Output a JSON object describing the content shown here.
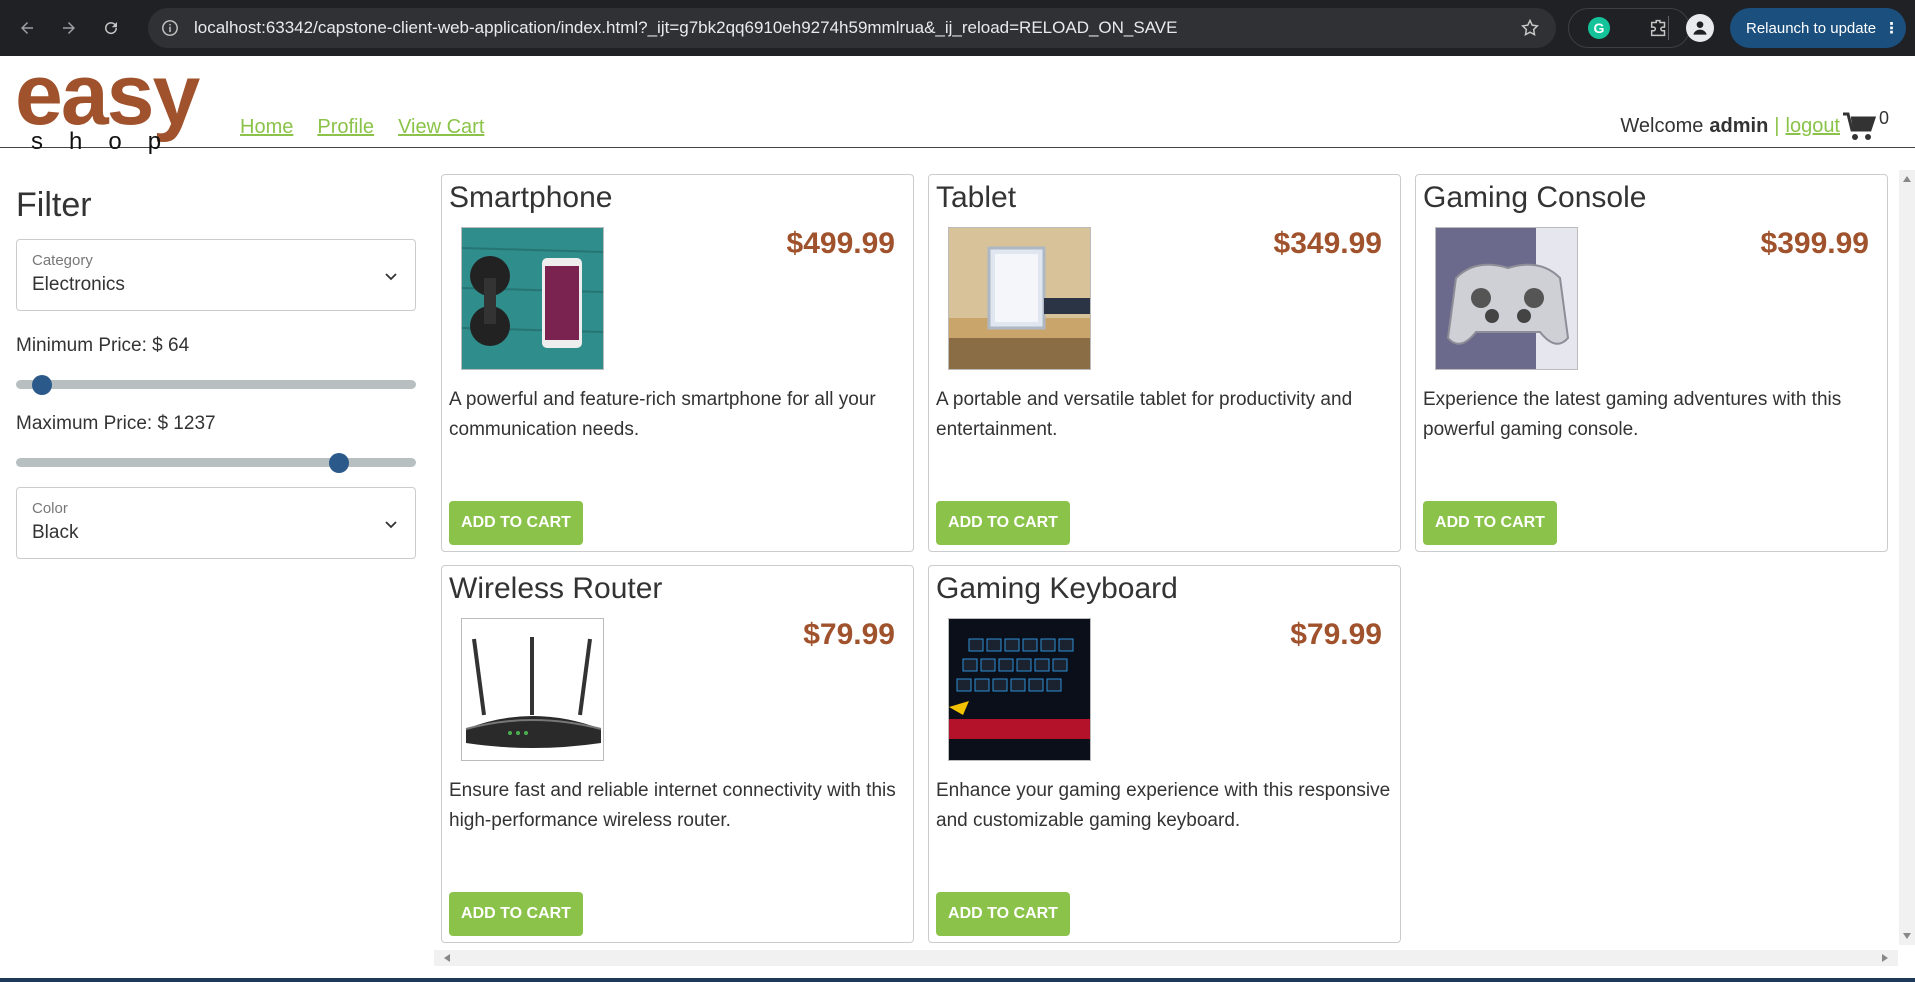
{
  "browser": {
    "url": "localhost:63342/capstone-client-web-application/index.html?_ijt=g7bk2qq6910eh9274h59mmlrua&_ij_reload=RELOAD_ON_SAVE",
    "relaunch_label": "Relaunch to update",
    "relaunch_menu": "⋮",
    "extension_letter": "G"
  },
  "header": {
    "logo_top": "easy",
    "logo_bottom": "shop",
    "nav": {
      "home": "Home",
      "profile": "Profile",
      "cart": "View Cart"
    },
    "welcome": "Welcome",
    "username": "admin",
    "separator": "|",
    "logout": "logout",
    "cart_count": "0"
  },
  "filter": {
    "title": "Filter",
    "category": {
      "label": "Category",
      "value": "Electronics"
    },
    "min_price": {
      "label": "Minimum Price: $ 64",
      "value": 64,
      "min": 0,
      "max": 1500
    },
    "max_price": {
      "label": "Maximum Price: $ 1237",
      "value": 1237,
      "min": 0,
      "max": 1500
    },
    "color": {
      "label": "Color",
      "value": "Black"
    }
  },
  "products": [
    {
      "name": "Smartphone",
      "price": "$499.99",
      "description": "A powerful and feature-rich smartphone for all your communication needs.",
      "button": "ADD TO CART"
    },
    {
      "name": "Tablet",
      "price": "$349.99",
      "description": "A portable and versatile tablet for productivity and entertainment.",
      "button": "ADD TO CART"
    },
    {
      "name": "Gaming Console",
      "price": "$399.99",
      "description": "Experience the latest gaming adventures with this powerful gaming console.",
      "button": "ADD TO CART"
    },
    {
      "name": "Wireless Router",
      "price": "$79.99",
      "description": "Ensure fast and reliable internet connectivity with this high-performance wireless router.",
      "button": "ADD TO CART"
    },
    {
      "name": "Gaming Keyboard",
      "price": "$79.99",
      "description": "Enhance your gaming experience with this responsive and customizable gaming keyboard.",
      "button": "ADD TO CART"
    }
  ],
  "colors": {
    "accent": "#8bc34a",
    "price": "#a0522d",
    "slider_thumb": "#2b5a8a",
    "brand": "#a0522d"
  }
}
